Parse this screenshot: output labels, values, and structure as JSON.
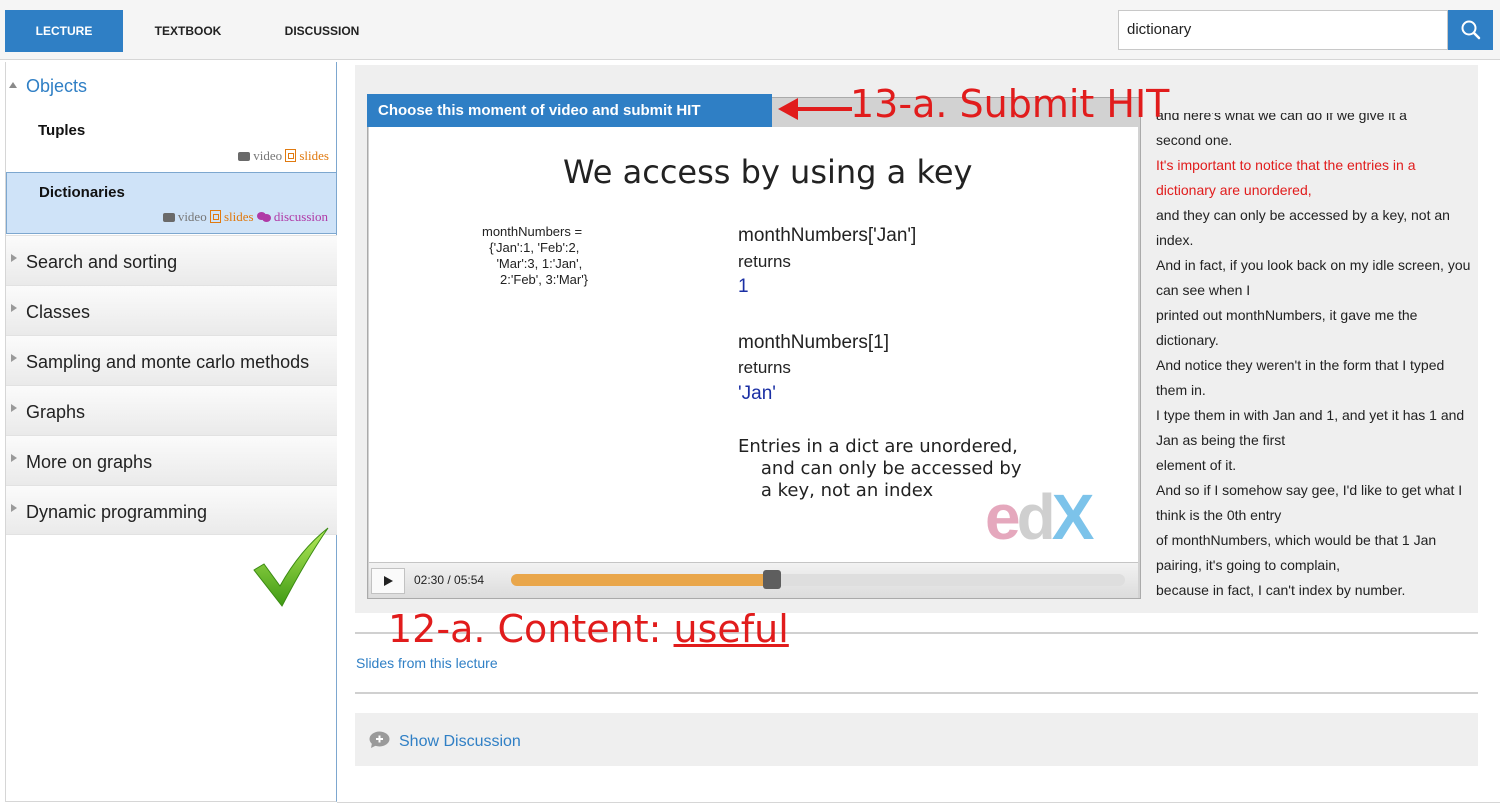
{
  "tabs": [
    {
      "label": "LECTURE",
      "active": true
    },
    {
      "label": "TEXTBOOK",
      "active": false
    },
    {
      "label": "DISCUSSION",
      "active": false
    }
  ],
  "search": {
    "value": "dictionary",
    "icon": "search-icon"
  },
  "sidebar": {
    "open_chapter": "Objects",
    "subsections": [
      {
        "title": "Tuples",
        "video": "video",
        "slides": "slides"
      },
      {
        "title": "Dictionaries",
        "video": "video",
        "slides": "slides",
        "discussion": "discussion"
      }
    ],
    "chapters": [
      "Search and sorting",
      "Classes",
      "Sampling and monte carlo methods",
      "Graphs",
      "More on graphs",
      "Dynamic programming"
    ]
  },
  "video": {
    "submit_label": "Choose this moment of video and submit HIT",
    "slide": {
      "title": "We access by using a key",
      "code": "monthNumbers =\n  {'Jan':1, 'Feb':2,\n    'Mar':3, 1:'Jan',\n     2:'Feb', 3:'Mar'}",
      "expr1": "monthNumbers['Jan']",
      "returns1": "returns",
      "value1": "1",
      "expr2": "monthNumbers[1]",
      "returns2": "returns",
      "value2": "'Jan'",
      "note": "Entries in a dict are unordered,\n    and can only be accessed by\n    a key, not an index",
      "logo": {
        "e": "e",
        "d": "d",
        "x": "X"
      }
    },
    "time": "02:30 / 05:54",
    "progress": 0.42
  },
  "transcript": {
    "lines": [
      {
        "text": "and here's what we can do if we give it a",
        "highlight": false
      },
      {
        "text": "second one.",
        "highlight": false
      },
      {
        "text": "It's important to notice that the entries in a dictionary are unordered,",
        "highlight": true
      },
      {
        "text": "and they can only be accessed by a key, not an index.",
        "highlight": false
      },
      {
        "text": "And in fact, if you look back on my idle screen, you can see when I",
        "highlight": false
      },
      {
        "text": "printed out monthNumbers, it gave me the dictionary.",
        "highlight": false
      },
      {
        "text": "And notice they weren't in the form that I typed them in.",
        "highlight": false
      },
      {
        "text": "I type them in with Jan and 1, and yet it has 1 and Jan as being the first",
        "highlight": false
      },
      {
        "text": "element of it.",
        "highlight": false
      },
      {
        "text": "And so if I somehow say gee, I'd like to get what I think is the 0th entry",
        "highlight": false
      },
      {
        "text": "of monthNumbers, which would be that 1 Jan pairing, it's going to complain,",
        "highlight": false
      },
      {
        "text": "because in fact, I can't index by number.",
        "highlight": false
      }
    ]
  },
  "annotations": {
    "submit": "13-a. Submit HIT",
    "content_prefix": "12-a. Content: ",
    "content_value": "useful"
  },
  "slides_link": "Slides from this lecture",
  "show_discussion": "Show Discussion",
  "colors": {
    "accent": "#2f7fc5",
    "annotation": "#e11c1c",
    "progress": "#e9a64a"
  }
}
